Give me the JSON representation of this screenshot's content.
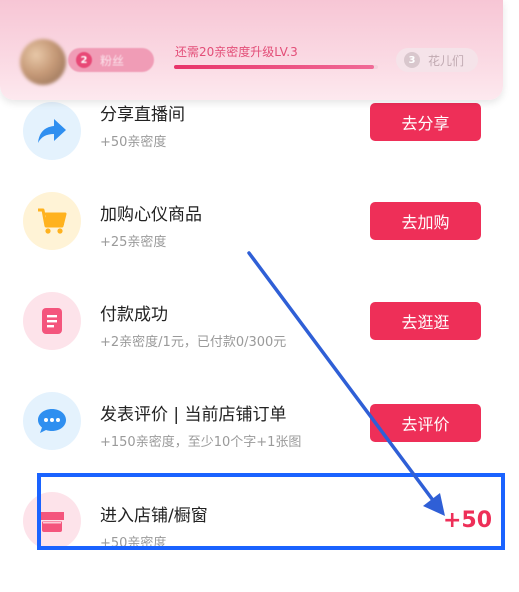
{
  "header": {
    "current_level": "2",
    "current_level_name": "粉丝",
    "upgrade_text": "还需20亲密度升级LV.3",
    "progress": 0.98,
    "next_level": "3",
    "next_level_name": "花儿们"
  },
  "tasks": [
    {
      "title": "分享直播间",
      "reward": "+50亲密度",
      "button": "去分享",
      "icon": "share-arrow-icon",
      "color": "#2f8ff0"
    },
    {
      "title": "加购心仪商品",
      "reward": "+25亲密度",
      "button": "去加购",
      "icon": "shopping-cart-icon",
      "color": "#ffb21e"
    },
    {
      "title": "付款成功",
      "reward": "+2亲密度/1元，已付款0/300元",
      "button": "去逛逛",
      "icon": "bill-icon",
      "color": "#f4557d"
    },
    {
      "title": "发表评价 | 当前店铺订单",
      "reward": "+150亲密度，至少10个字+1张图",
      "button": "去评价",
      "icon": "chat-bubble-icon",
      "color": "#2f8ff0"
    },
    {
      "title": "进入店铺/橱窗",
      "reward": "+50亲密度",
      "done_value": "+50",
      "icon": "store-icon",
      "color": "#f4557d"
    }
  ],
  "colors": {
    "accent": "#ee2f58",
    "annotation": "#1a63ff"
  }
}
